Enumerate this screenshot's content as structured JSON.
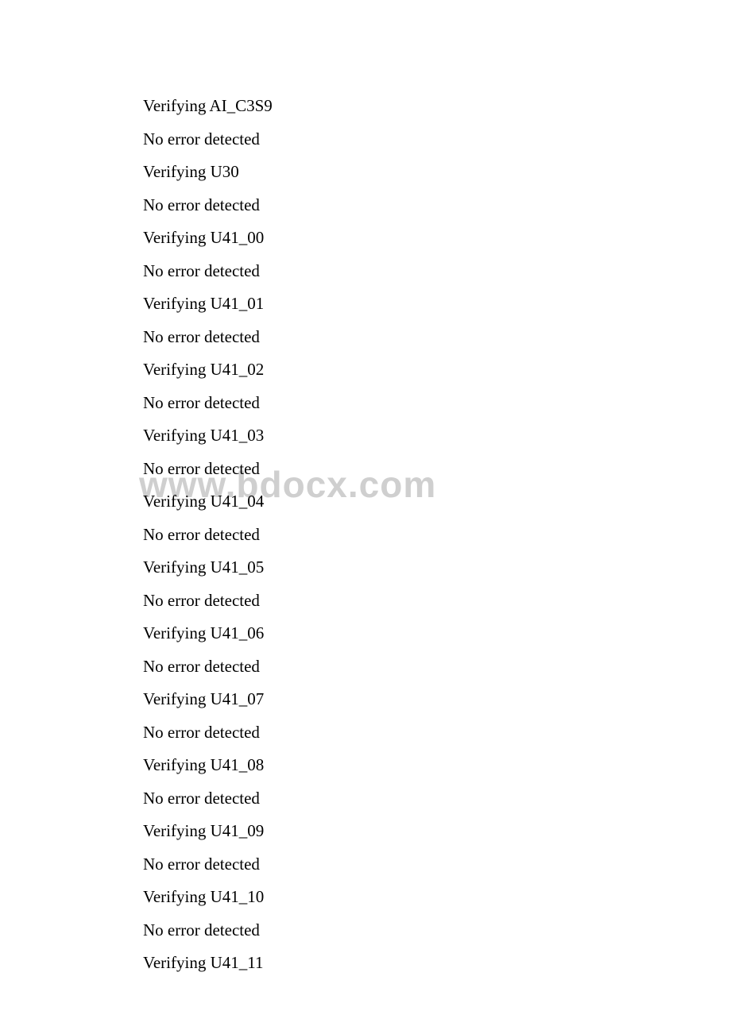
{
  "watermark": "www.bdocx.com",
  "lines": [
    "Verifying AI_C3S9",
    "No error detected",
    "Verifying U30",
    "No error detected",
    "Verifying U41_00",
    "No error detected",
    "Verifying U41_01",
    "No error detected",
    "Verifying U41_02",
    "No error detected",
    "Verifying U41_03",
    "No error detected",
    "Verifying U41_04",
    "No error detected",
    "Verifying U41_05",
    "No error detected",
    "Verifying U41_06",
    "No error detected",
    "Verifying U41_07",
    "No error detected",
    "Verifying U41_08",
    "No error detected",
    "Verifying U41_09",
    "No error detected",
    "Verifying U41_10",
    "No error detected",
    "Verifying U41_11"
  ]
}
